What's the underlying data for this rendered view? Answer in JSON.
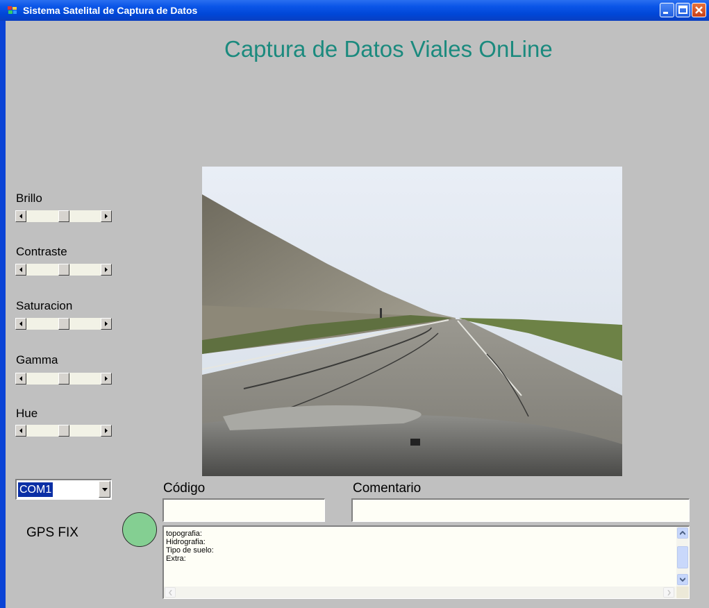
{
  "window": {
    "title": "Sistema Satelital de Captura de Datos",
    "icons": [
      "app-icon",
      "minimize-icon",
      "maximize-icon",
      "close-icon"
    ]
  },
  "header": {
    "title": "Captura de Datos Viales OnLine"
  },
  "sliders": [
    {
      "label": "Brillo",
      "level": 0.5
    },
    {
      "label": "Contraste",
      "level": 0.5
    },
    {
      "label": "Saturacion",
      "level": 0.5
    },
    {
      "label": "Gamma",
      "level": 0.5
    },
    {
      "label": "Hue",
      "level": 0.5
    }
  ],
  "port_select": {
    "value": "COM1"
  },
  "gps": {
    "label": "GPS FIX",
    "status_color": "#84cf92"
  },
  "fields": {
    "code_label": "Código",
    "code_value": "",
    "comment_label": "Comentario",
    "comment_value": ""
  },
  "memo": {
    "lines": [
      "topografia:",
      "Hidrografia:",
      "Tipo de suelo:",
      "Extra:"
    ]
  },
  "colors": {
    "title_bar": "#0046d6",
    "app_title": "#1b8a7e",
    "background": "#c0c0c0"
  }
}
